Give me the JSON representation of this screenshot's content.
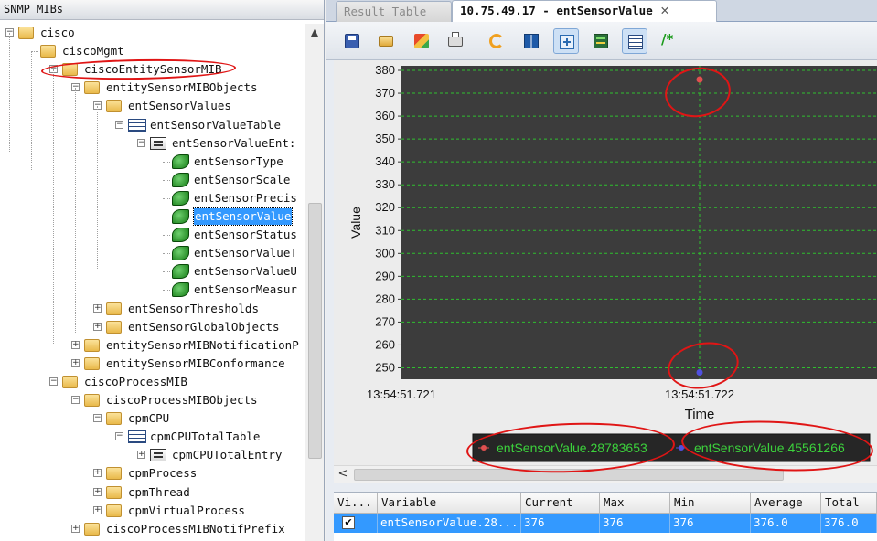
{
  "tree_panel": {
    "title": "SNMP MIBs",
    "nodes": [
      {
        "label": "cisco",
        "toggle": "−",
        "icon": "folder-icon"
      },
      {
        "label": "ciscoMgmt",
        "toggle": "",
        "icon": "folder-icon"
      },
      {
        "label": "ciscoEntitySensorMIB",
        "toggle": "−",
        "icon": "folder-icon"
      },
      {
        "label": "entitySensorMIBObjects",
        "toggle": "−",
        "icon": "folder-icon"
      },
      {
        "label": "entSensorValues",
        "toggle": "−",
        "icon": "folder-icon"
      },
      {
        "label": "entSensorValueTable",
        "toggle": "−",
        "icon": "table-icon"
      },
      {
        "label": "entSensorValueEnt:",
        "toggle": "−",
        "icon": "entry-icon"
      },
      {
        "label": "entSensorType",
        "toggle": "",
        "icon": "leaf-icon"
      },
      {
        "label": "entSensorScale",
        "toggle": "",
        "icon": "leaf-icon"
      },
      {
        "label": "entSensorPrecis",
        "toggle": "",
        "icon": "leaf-icon"
      },
      {
        "label": "entSensorValue",
        "toggle": "",
        "icon": "leaf-icon",
        "selected": true
      },
      {
        "label": "entSensorStatus",
        "toggle": "",
        "icon": "leaf-icon"
      },
      {
        "label": "entSensorValueT",
        "toggle": "",
        "icon": "leaf-icon"
      },
      {
        "label": "entSensorValueU",
        "toggle": "",
        "icon": "leaf-icon"
      },
      {
        "label": "entSensorMeasur",
        "toggle": "",
        "icon": "leaf-icon"
      },
      {
        "label": "entSensorThresholds",
        "toggle": "+",
        "icon": "folder-icon"
      },
      {
        "label": "entSensorGlobalObjects",
        "toggle": "+",
        "icon": "folder-icon"
      },
      {
        "label": "entitySensorMIBNotificationP",
        "toggle": "+",
        "icon": "folder-icon"
      },
      {
        "label": "entitySensorMIBConformance",
        "toggle": "+",
        "icon": "folder-icon"
      },
      {
        "label": "ciscoProcessMIB",
        "toggle": "−",
        "icon": "folder-icon"
      },
      {
        "label": "ciscoProcessMIBObjects",
        "toggle": "−",
        "icon": "folder-icon"
      },
      {
        "label": "cpmCPU",
        "toggle": "−",
        "icon": "folder-icon"
      },
      {
        "label": "cpmCPUTotalTable",
        "toggle": "−",
        "icon": "table-icon"
      },
      {
        "label": "cpmCPUTotalEntry",
        "toggle": "+",
        "icon": "entry-icon"
      },
      {
        "label": "cpmProcess",
        "toggle": "+",
        "icon": "folder-icon"
      },
      {
        "label": "cpmThread",
        "toggle": "+",
        "icon": "folder-icon"
      },
      {
        "label": "cpmVirtualProcess",
        "toggle": "+",
        "icon": "folder-icon"
      },
      {
        "label": "ciscoProcessMIBNotifPrefix",
        "toggle": "+",
        "icon": "folder-icon"
      }
    ],
    "scroll_up": "▲"
  },
  "tabs": {
    "result_table": "Result Table",
    "graph": "10.75.49.17 - entSensorValue",
    "close": "✕"
  },
  "toolbar": {
    "icons": [
      "save-icon",
      "open-icon",
      "settings-icon",
      "print-icon",
      "refresh-icon",
      "split-view-icon",
      "zoom-fit-icon",
      "chart-view-icon",
      "table-view-icon",
      "comment-icon"
    ],
    "comment_glyph": "/*"
  },
  "chart_data": {
    "type": "scatter",
    "ylabel": "Value",
    "xlabel": "Time",
    "ylim": [
      245,
      382
    ],
    "yticks": [
      250,
      260,
      270,
      280,
      290,
      300,
      310,
      320,
      330,
      340,
      350,
      360,
      370,
      380
    ],
    "xticks": [
      "13:54:51.721",
      "13:54:51.722"
    ],
    "grid": true,
    "legend_placement": "bottom",
    "series": [
      {
        "name": "entSensorValue.28783653",
        "color": "#e05050",
        "points": [
          {
            "x": "13:54:51.722",
            "y": 376
          }
        ]
      },
      {
        "name": "entSensorValue.45561266",
        "color": "#5050e0",
        "points": [
          {
            "x": "13:54:51.722",
            "y": 248
          }
        ]
      }
    ],
    "plot_bg": "#3c3c3c",
    "grid_color": "#2fbf2f",
    "legend_text_color": "#3cd23c"
  },
  "h_scroll": {
    "left_arrow": "<"
  },
  "table": {
    "columns": [
      "Vi...",
      "Variable",
      "Current",
      "Max",
      "Min",
      "Average",
      "Total"
    ],
    "rows": [
      {
        "visible": "✔",
        "variable": "entSensorValue.28...",
        "current": "376",
        "max": "376",
        "min": "376",
        "average": "376.0",
        "total": "376.0"
      }
    ]
  }
}
